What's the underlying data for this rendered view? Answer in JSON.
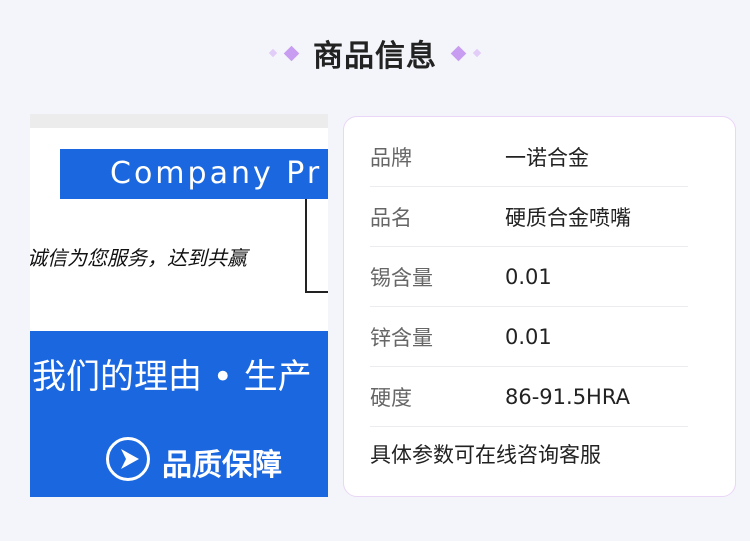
{
  "header": {
    "title": "商品信息"
  },
  "banner": {
    "company_text": "Company Pr",
    "slogan": "诚信为您服务，达到共赢",
    "reason_text": "我们的理由 • 生产",
    "quality_label": "品质保障",
    "colors": {
      "blue": "#1a67e0"
    }
  },
  "specs": {
    "rows": [
      {
        "label": "品牌",
        "value": "一诺合金"
      },
      {
        "label": "品名",
        "value": "硬质合金喷嘴"
      },
      {
        "label": "锡含量",
        "value": "0.01"
      },
      {
        "label": "锌含量",
        "value": "0.01"
      },
      {
        "label": "硬度",
        "value": "86-91.5HRA"
      }
    ],
    "footer_note": "具体参数可在线咨询客服"
  },
  "colors": {
    "accent": "#c79cf1",
    "card_border": "#ead6f6",
    "background": "#f4f5fb"
  }
}
